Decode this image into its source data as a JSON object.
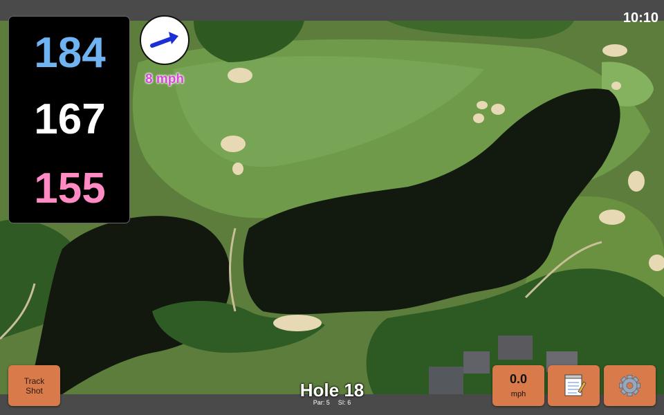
{
  "status": {
    "clock": "10:10"
  },
  "distances": {
    "back": "184",
    "middle": "167",
    "front": "155"
  },
  "wind": {
    "speed_label": "8 mph",
    "icon": "wind-direction-arrow-icon"
  },
  "hole": {
    "title": "Hole 18",
    "par": "Par: 5",
    "si": "SI: 6"
  },
  "buttons": {
    "track_line1": "Track",
    "track_line2": "Shot",
    "speed_value": "0.0",
    "speed_unit": "mph",
    "notes_icon": "notepad-icon",
    "settings_icon": "gear-icon"
  },
  "colors": {
    "back": "#6fb3f2",
    "middle": "#ffffff",
    "front": "#ff8ac4",
    "wind_text": "#d848d8",
    "button": "#d87a4a"
  }
}
